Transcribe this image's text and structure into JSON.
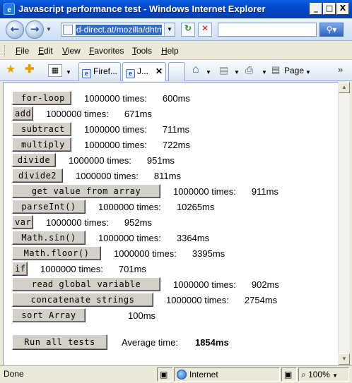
{
  "window": {
    "title": "Javascript performance test - Windows Internet Explorer",
    "minimize": "_",
    "maximize": "□",
    "close": "X"
  },
  "address": {
    "url": "d-direct.at/mozilla/dhtml/j",
    "search_value": ""
  },
  "menu": [
    "File",
    "Edit",
    "View",
    "Favorites",
    "Tools",
    "Help"
  ],
  "tabs": [
    {
      "label": "Firef..."
    },
    {
      "label": "J..."
    }
  ],
  "commands": {
    "page_label": "Page"
  },
  "tests": [
    {
      "label": "for-loop",
      "times": "1000000 times:",
      "ms": "600ms"
    },
    {
      "label": "add",
      "times": "1000000 times:",
      "ms": "671ms"
    },
    {
      "label": "subtract",
      "times": "1000000 times:",
      "ms": "711ms"
    },
    {
      "label": "multiply",
      "times": "1000000 times:",
      "ms": "722ms"
    },
    {
      "label": "divide",
      "times": "1000000 times:",
      "ms": "951ms"
    },
    {
      "label": "divide2",
      "times": "1000000 times:",
      "ms": "811ms"
    },
    {
      "label": "get value from array",
      "times": "1000000 times:",
      "ms": "911ms"
    },
    {
      "label": "parseInt()",
      "times": "1000000 times:",
      "ms": "10265ms"
    },
    {
      "label": "var",
      "times": "1000000 times:",
      "ms": "952ms"
    },
    {
      "label": "Math.sin()",
      "times": "1000000 times:",
      "ms": "3364ms"
    },
    {
      "label": "Math.floor()",
      "times": "1000000 times:",
      "ms": "3395ms"
    },
    {
      "label": "if",
      "times": "1000000 times:",
      "ms": "701ms"
    },
    {
      "label": "read global variable",
      "times": "1000000 times:",
      "ms": "902ms"
    },
    {
      "label": "concatenate strings",
      "times": "1000000 times:",
      "ms": "2754ms"
    },
    {
      "label": "sort Array",
      "times": "",
      "ms": "100ms"
    }
  ],
  "run_all": {
    "label": "Run all tests",
    "average_label": "Average time:",
    "average_value": "1854ms"
  },
  "status": {
    "text": "Done",
    "zone": "Internet",
    "zoom": "100%"
  }
}
